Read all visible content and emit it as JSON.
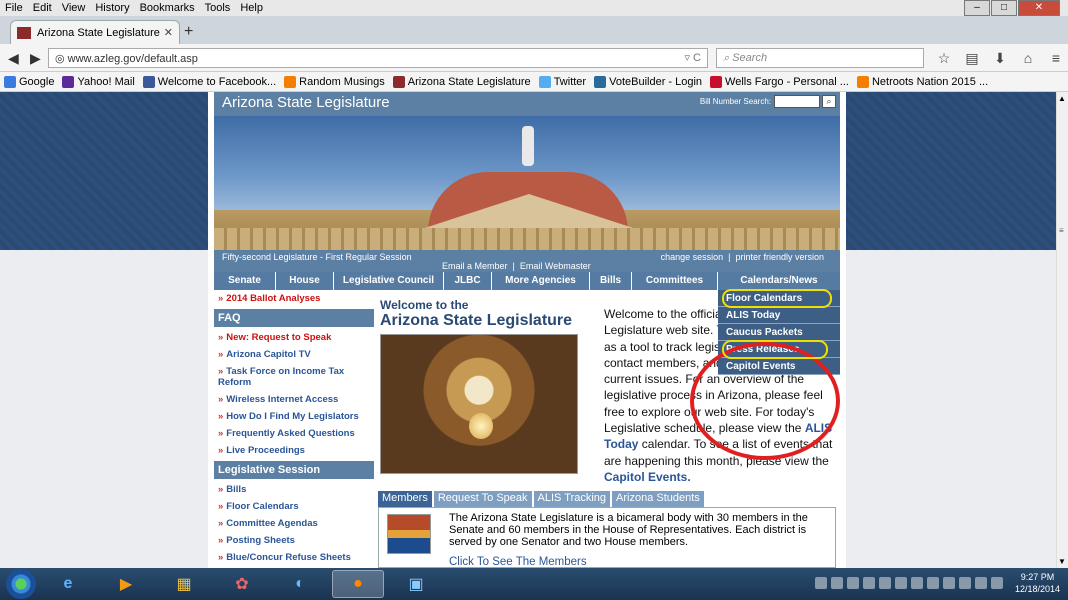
{
  "browser": {
    "menu": [
      "File",
      "Edit",
      "View",
      "History",
      "Bookmarks",
      "Tools",
      "Help"
    ],
    "tab_title": "Arizona State Legislature",
    "url": "www.azleg.gov/default.asp",
    "search_placeholder": "Search",
    "bookmarks": [
      {
        "label": "Google",
        "color": "#3a7be0"
      },
      {
        "label": "Yahoo! Mail",
        "color": "#5e2a9a"
      },
      {
        "label": "Welcome to Facebook...",
        "color": "#3b5998"
      },
      {
        "label": "Random Musings",
        "color": "#f57d00"
      },
      {
        "label": "Arizona State Legislature",
        "color": "#8b2b2b"
      },
      {
        "label": "Twitter",
        "color": "#55acee"
      },
      {
        "label": "VoteBuilder - Login",
        "color": "#2a6a9a"
      },
      {
        "label": "Wells Fargo - Personal ...",
        "color": "#c8102e"
      },
      {
        "label": "Netroots Nation 2015 ...",
        "color": "#f57d00"
      }
    ]
  },
  "site": {
    "title": "Arizona State Legislature",
    "bill_search_label": "Bill Number Search:",
    "session": "Fifty-second Legislature - First Regular Session",
    "change_session": "change session",
    "printer_friendly": "printer friendly version",
    "email_member": "Email a Member",
    "email_webmaster": "Email Webmaster",
    "nav": [
      "Senate",
      "House",
      "Legislative Council",
      "JLBC",
      "More Agencies",
      "Bills",
      "Committees",
      "Calendars/News"
    ],
    "dropdown": [
      "Floor Calendars",
      "ALIS Today",
      "Caucus Packets",
      "Press Releases",
      "Capitol Events"
    ],
    "left": {
      "ballot": "2014 Ballot Analyses",
      "faq_head": "FAQ",
      "faq_items": [
        "New: Request to Speak",
        "Arizona Capitol TV",
        "Task Force on Income Tax Reform",
        "Wireless Internet Access",
        "How Do I Find My Legislators",
        "Frequently Asked Questions",
        "Live Proceedings"
      ],
      "session_head": "Legislative Session",
      "session_items": [
        "Bills",
        "Floor Calendars",
        "Committee Agendas",
        "Posting Sheets",
        "Blue/Concur Refuse Sheets"
      ]
    },
    "welcome_l1": "Welcome to the",
    "welcome_l2": "Arizona State Legislature",
    "welcome_p1": "Welcome to the official Arizona State Legislature web site. This site is designed as a tool to track legislation, locate and contact members, and stay up-to-date on current issues. For an overview of the legislative process in Arizona, please feel free to explore our web site. For today's Legislative schedule, please view the",
    "alis_link": "ALIS Today",
    "welcome_p2": "calendar. To see a list of events that are happening this month, please view the",
    "events_link": "Capitol Events.",
    "tabs": [
      "Members",
      "Request To Speak",
      "ALIS Tracking",
      "Arizona Students"
    ],
    "members_text": "The Arizona State Legislature is a bicameral body with 30 members in the Senate and 60 members in the House of Representatives. Each district is served by one Senator and two House members.",
    "members_link": "Click To See The Members"
  },
  "taskbar": {
    "time": "9:27 PM",
    "date": "12/18/2014"
  }
}
